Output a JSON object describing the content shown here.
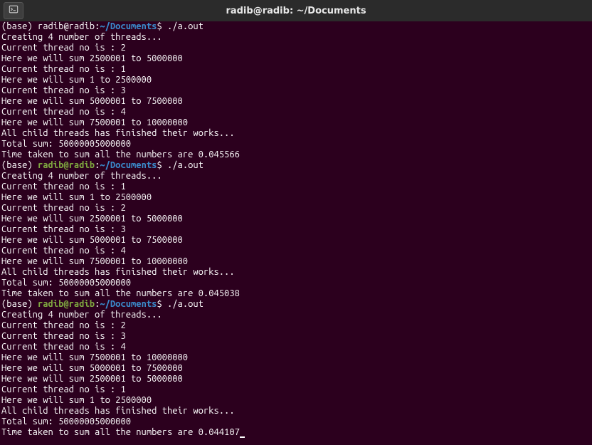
{
  "titlebar": {
    "title": "radib@radib: ~/Documents"
  },
  "prompt": {
    "base": "(base) ",
    "user": "radib@radib",
    "sep": ":",
    "path": "~/Documents",
    "dollar": "$ ",
    "cmd": "./a.out"
  },
  "lines": [
    {
      "t": "prompt_cut"
    },
    {
      "t": "out",
      "v": "Creating 4 number of threads..."
    },
    {
      "t": "out",
      "v": "Current thread no is : 2"
    },
    {
      "t": "out",
      "v": "Here we will sum 2500001 to 5000000"
    },
    {
      "t": "out",
      "v": "Current thread no is : 1"
    },
    {
      "t": "out",
      "v": "Here we will sum 1 to 2500000"
    },
    {
      "t": "out",
      "v": "Current thread no is : 3"
    },
    {
      "t": "out",
      "v": "Here we will sum 5000001 to 7500000"
    },
    {
      "t": "out",
      "v": "Current thread no is : 4"
    },
    {
      "t": "out",
      "v": "Here we will sum 7500001 to 10000000"
    },
    {
      "t": "out",
      "v": "All child threads has finished their works..."
    },
    {
      "t": "out",
      "v": "Total sum: 50000005000000"
    },
    {
      "t": "out",
      "v": "Time taken to sum all the numbers are 0.045566"
    },
    {
      "t": "prompt"
    },
    {
      "t": "out",
      "v": "Creating 4 number of threads..."
    },
    {
      "t": "out",
      "v": "Current thread no is : 1"
    },
    {
      "t": "out",
      "v": "Here we will sum 1 to 2500000"
    },
    {
      "t": "out",
      "v": "Current thread no is : 2"
    },
    {
      "t": "out",
      "v": "Here we will sum 2500001 to 5000000"
    },
    {
      "t": "out",
      "v": "Current thread no is : 3"
    },
    {
      "t": "out",
      "v": "Here we will sum 5000001 to 7500000"
    },
    {
      "t": "out",
      "v": "Current thread no is : 4"
    },
    {
      "t": "out",
      "v": "Here we will sum 7500001 to 10000000"
    },
    {
      "t": "out",
      "v": "All child threads has finished their works..."
    },
    {
      "t": "out",
      "v": "Total sum: 50000005000000"
    },
    {
      "t": "out",
      "v": "Time taken to sum all the numbers are 0.045038"
    },
    {
      "t": "prompt"
    },
    {
      "t": "out",
      "v": "Creating 4 number of threads..."
    },
    {
      "t": "out",
      "v": "Current thread no is : 2"
    },
    {
      "t": "out",
      "v": "Current thread no is : 3"
    },
    {
      "t": "out",
      "v": "Current thread no is : 4"
    },
    {
      "t": "out",
      "v": "Here we will sum 7500001 to 10000000"
    },
    {
      "t": "out",
      "v": "Here we will sum 5000001 to 7500000"
    },
    {
      "t": "out",
      "v": "Here we will sum 2500001 to 5000000"
    },
    {
      "t": "out",
      "v": "Current thread no is : 1"
    },
    {
      "t": "out",
      "v": "Here we will sum 1 to 2500000"
    },
    {
      "t": "out",
      "v": "All child threads has finished their works..."
    },
    {
      "t": "out",
      "v": "Total sum: 50000005000000"
    },
    {
      "t": "out",
      "v": "Time taken to sum all the numbers are 0.044107",
      "cursor": true
    }
  ]
}
